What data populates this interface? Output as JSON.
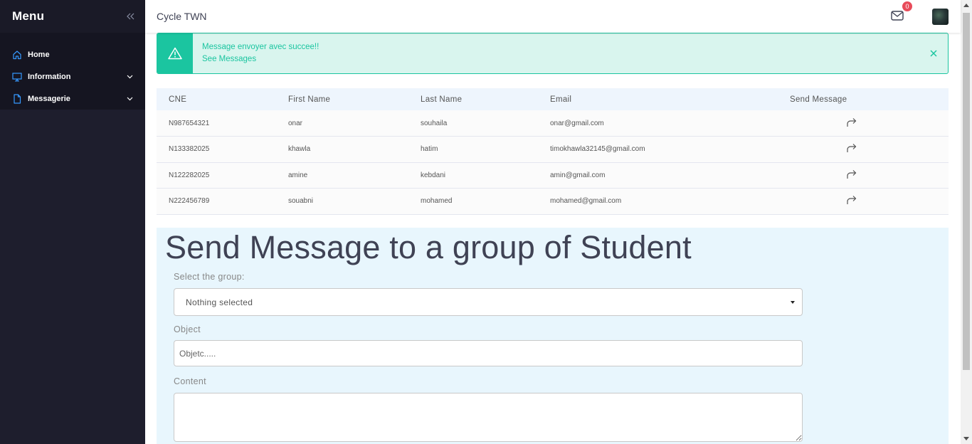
{
  "sidebar": {
    "title": "Menu",
    "items": [
      {
        "label": "Home",
        "icon": "home-icon"
      },
      {
        "label": "Information",
        "icon": "monitor-icon"
      },
      {
        "label": "Messagerie",
        "icon": "file-icon"
      }
    ]
  },
  "topbar": {
    "title": "Cycle TWN",
    "mail_badge": "0"
  },
  "alert": {
    "message": "Message envoyer avec succee!!",
    "link": "See Messages",
    "color": "#1bc5a0"
  },
  "table": {
    "headers": {
      "cne": "CNE",
      "first": "First Name",
      "last": "Last Name",
      "email": "Email",
      "send": "Send Message"
    },
    "rows": [
      {
        "cne": "N987654321",
        "first": "onar",
        "last": "souhaila",
        "email": "onar@gmail.com"
      },
      {
        "cne": "N133382025",
        "first": "khawla",
        "last": "hatim",
        "email": "timokhawla32145@gmail.com"
      },
      {
        "cne": "N122282025",
        "first": "amine",
        "last": "kebdani",
        "email": "amin@gmail.com"
      },
      {
        "cne": "N222456789",
        "first": "souabni",
        "last": "mohamed",
        "email": "mohamed@gmail.com"
      }
    ]
  },
  "group_form": {
    "title": "Send Message to a group of Student",
    "group_label": "Select the group:",
    "group_value": "Nothing selected",
    "object_label": "Object",
    "object_placeholder": "Objetc.....",
    "content_label": "Content"
  }
}
